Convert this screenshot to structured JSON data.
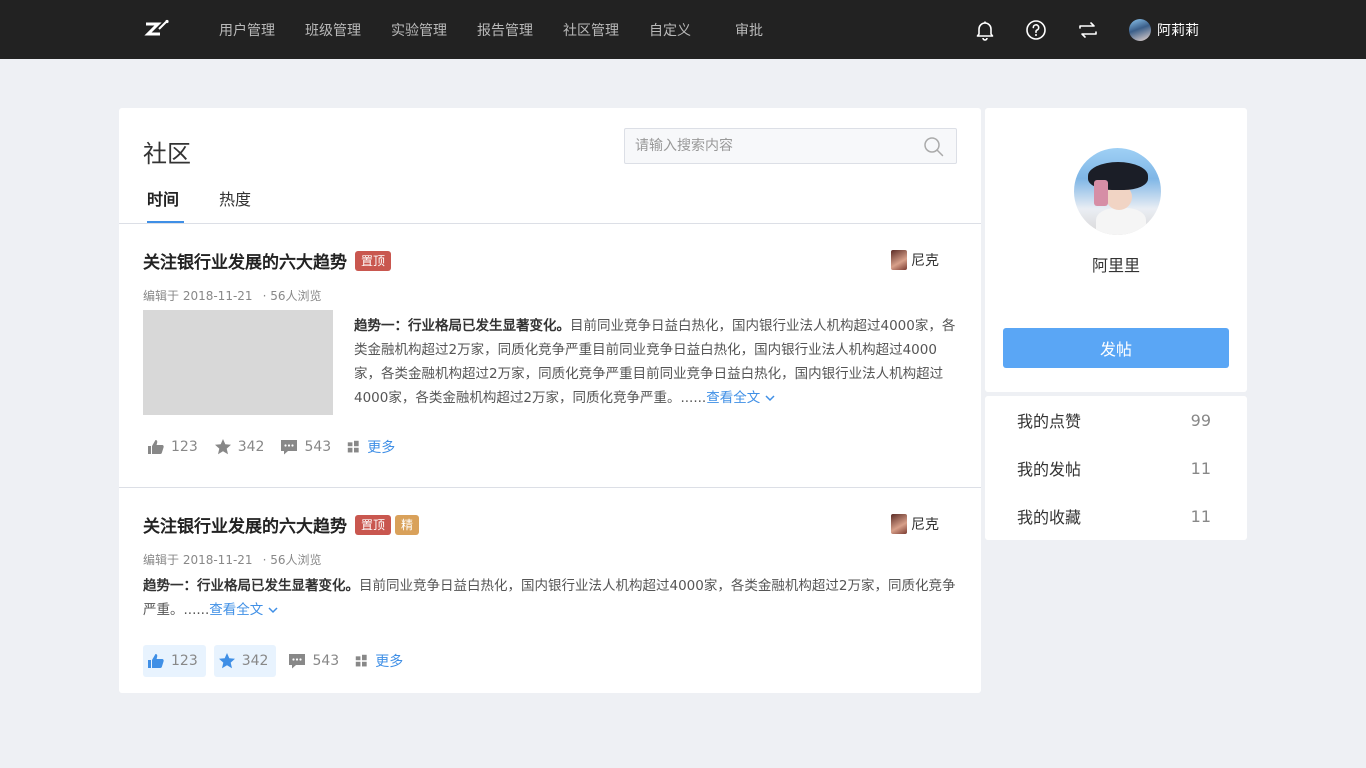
{
  "nav": {
    "items": [
      {
        "label": "用户管理"
      },
      {
        "label": "班级管理"
      },
      {
        "label": "实验管理"
      },
      {
        "label": "报告管理"
      },
      {
        "label": "社区管理"
      },
      {
        "label": "自定义"
      },
      {
        "label": "审批"
      }
    ],
    "icons": [
      "bell-icon",
      "help-icon",
      "switch-icon"
    ],
    "user_name": "阿莉莉"
  },
  "page": {
    "title": "社区",
    "search_placeholder": "请输入搜索内容",
    "tabs": [
      {
        "label": "时间",
        "active": true
      },
      {
        "label": "热度",
        "active": false
      }
    ]
  },
  "posts": [
    {
      "title": "关注银行业发展的六大趋势",
      "badges": [
        "置顶"
      ],
      "author": "尼克",
      "edited": "编辑于 2018-11-21",
      "views": "· 56人浏览",
      "excerpt_lead": "趋势一：行业格局已发生显著变化。",
      "excerpt_body": "目前同业竞争日益白热化，国内银行业法人机构超过4000家，各类金融机构超过2万家，同质化竞争严重目前同业竞争日益白热化，国内银行业法人机构超过4000家，各类金融机构超过2万家，同质化竞争严重目前同业竞争日益白热化，国内银行业法人机构超过4000家，各类金融机构超过2万家，同质化竞争严重。......",
      "read_more": "查看全文",
      "likes": "123",
      "stars": "342",
      "comments": "543",
      "more": "更多"
    },
    {
      "title": "关注银行业发展的六大趋势",
      "badges": [
        "置顶",
        "精"
      ],
      "author": "尼克",
      "edited": "编辑于 2018-11-21",
      "views": "· 56人浏览",
      "excerpt_lead": "趋势一：行业格局已发生显著变化。",
      "excerpt_body": "目前同业竞争日益白热化，国内银行业法人机构超过4000家，各类金融机构超过2万家，同质化竞争严重。......",
      "read_more": "查看全文",
      "likes": "123",
      "stars": "342",
      "comments": "543",
      "more": "更多"
    }
  ],
  "profile": {
    "name": "阿里里",
    "post_button": "发帖",
    "stats": [
      {
        "label": "我的点赞",
        "value": "99"
      },
      {
        "label": "我的发帖",
        "value": "11"
      },
      {
        "label": "我的收藏",
        "value": "11"
      }
    ]
  },
  "colors": {
    "topbar": "#222222",
    "accent": "#3f8fe6",
    "button": "#5aa6f5",
    "badge_top": "#c9574f",
    "badge_best": "#d9a15a"
  }
}
